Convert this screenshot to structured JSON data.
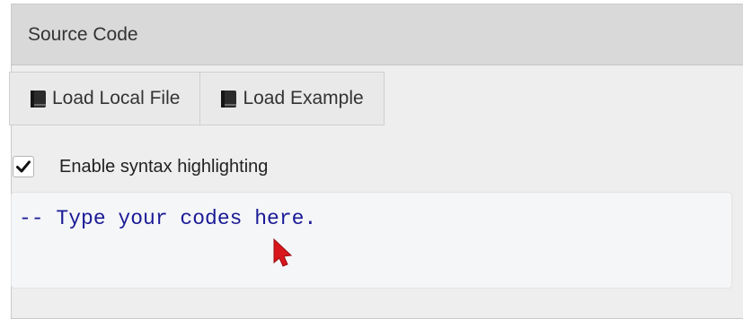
{
  "panel": {
    "title": "Source Code"
  },
  "toolbar": {
    "buttons": [
      {
        "label": "Load Local File",
        "icon": "book-icon"
      },
      {
        "label": "Load Example",
        "icon": "book-icon"
      }
    ]
  },
  "options": {
    "syntax_highlighting_label": "Enable syntax highlighting",
    "syntax_highlighting_checked": true
  },
  "editor": {
    "content": "-- Type your codes here.",
    "text_color": "#1a1a96"
  },
  "colors": {
    "pointer": "#d8161c"
  }
}
